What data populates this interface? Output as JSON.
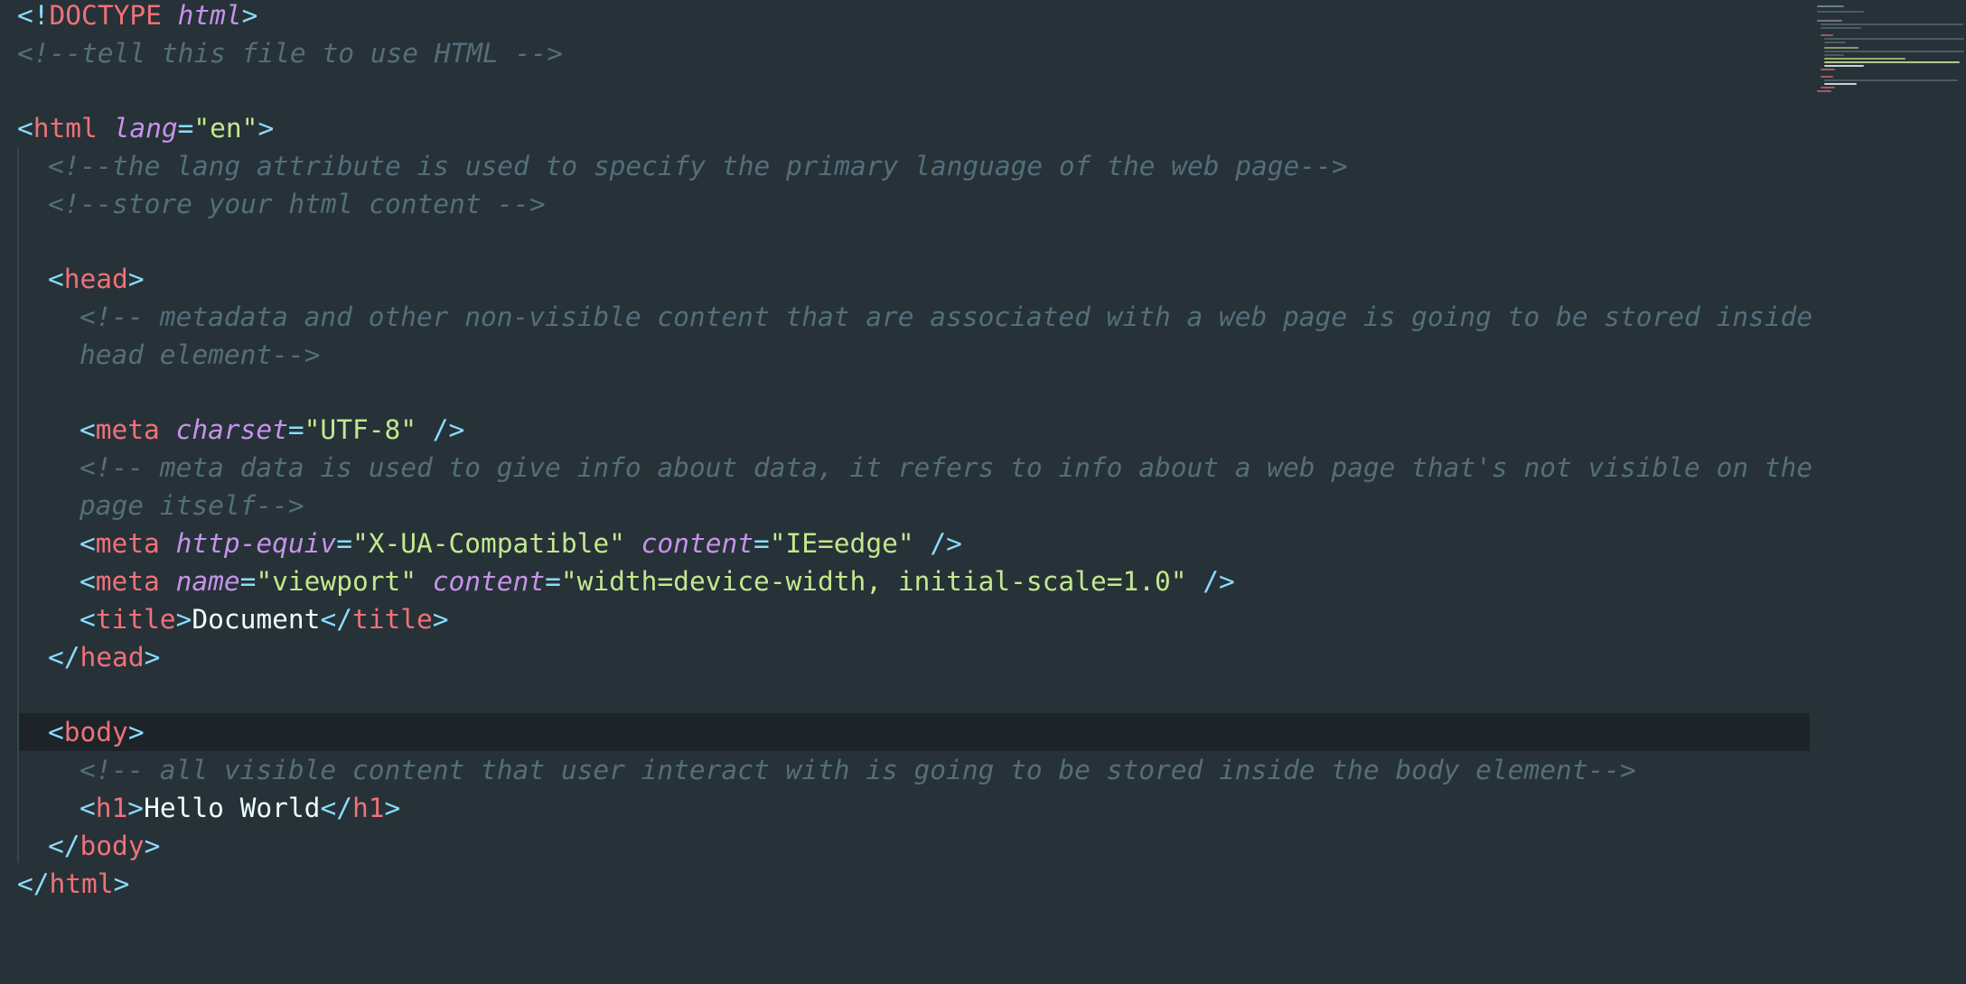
{
  "editor": {
    "language": "HTML",
    "theme": {
      "background": "#263238",
      "current_line": "#1c2429",
      "punctuation": "#89ddff",
      "tag": "#f07178",
      "attribute": "#c792ea",
      "string": "#c3e88d",
      "comment": "#546e7a",
      "text": "#eeffff"
    },
    "lines": {
      "l1": {
        "lt": "<!",
        "tag": "DOCTYPE",
        "attr": "html",
        "gt": ">"
      },
      "l2": {
        "comment": "<!--tell this file to use HTML -->"
      },
      "l4": {
        "lt": "<",
        "tag": "html",
        "attr": "lang",
        "eq": "=",
        "val": "\"en\"",
        "gt": ">"
      },
      "l5": {
        "comment": "<!--the lang attribute is used to specify the primary language of the web page-->"
      },
      "l6": {
        "comment": "<!--store your html content -->"
      },
      "l8": {
        "lt": "<",
        "tag": "head",
        "gt": ">"
      },
      "l9": {
        "comment_a": "<!-- metadata and other non-visible content that are associated with a web page is going to be stored inside",
        "comment_b": "head element-->"
      },
      "l11": {
        "lt": "<",
        "tag": "meta",
        "attr": "charset",
        "eq": "=",
        "val": "\"UTF-8\"",
        "close": " />"
      },
      "l12": {
        "comment_a": "<!-- meta data is used to give info about data, it refers to info about a web page that's not visible on the",
        "comment_b": "page itself-->"
      },
      "l13": {
        "lt": "<",
        "tag": "meta",
        "attr1": "http-equiv",
        "val1": "\"X-UA-Compatible\"",
        "attr2": "content",
        "val2": "\"IE=edge\"",
        "eq": "=",
        "close": " />"
      },
      "l14": {
        "lt": "<",
        "tag": "meta",
        "attr1": "name",
        "val1": "\"viewport\"",
        "attr2": "content",
        "val2": "\"width=device-width, initial-scale=1.0\"",
        "eq": "=",
        "close": " />"
      },
      "l15": {
        "lt": "<",
        "tag": "title",
        "gt": ">",
        "text": "Document",
        "lt_close": "</",
        "tag_close": "title",
        "gt_close": ">"
      },
      "l16": {
        "lt": "</",
        "tag": "head",
        "gt": ">"
      },
      "l18": {
        "lt": "<",
        "tag": "body",
        "gt": ">"
      },
      "l19": {
        "comment": "<!-- all visible content that user interact with is going to be stored inside the body element-->"
      },
      "l20": {
        "lt": "<",
        "tag": "h1",
        "gt": ">",
        "text": "Hello World",
        "lt_close": "</",
        "tag_close": "h1",
        "gt_close": ">"
      },
      "l21": {
        "lt": "</",
        "tag": "body",
        "gt": ">"
      },
      "l22": {
        "lt": "</",
        "tag": "html",
        "gt": ">"
      }
    }
  },
  "minimap": {
    "label": "minimap"
  }
}
